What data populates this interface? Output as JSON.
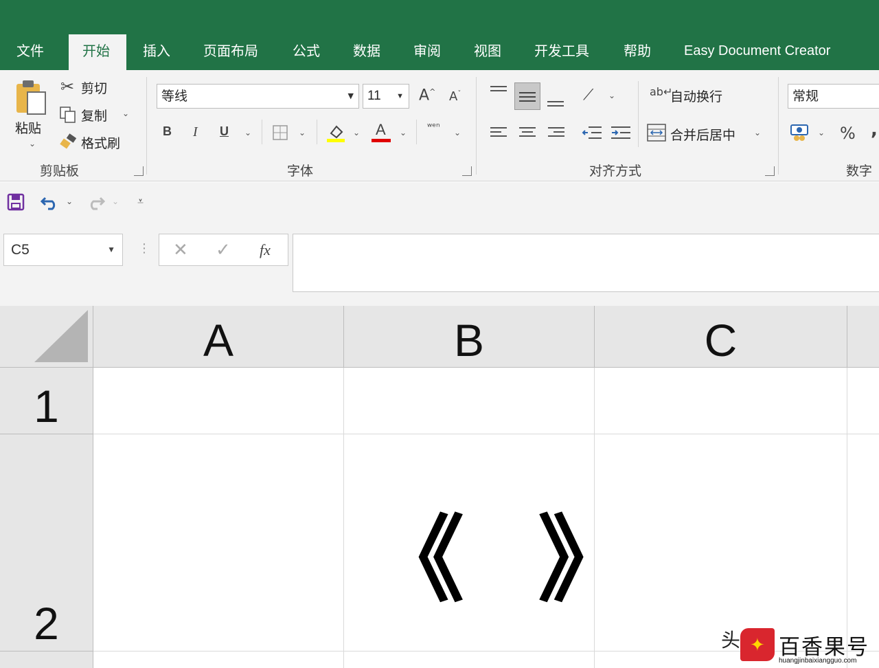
{
  "tabs": {
    "file": "文件",
    "home": "开始",
    "insert": "插入",
    "page_layout": "页面布局",
    "formulas": "公式",
    "data": "数据",
    "review": "审阅",
    "view": "视图",
    "developer": "开发工具",
    "help": "帮助",
    "addin": "Easy Document Creator"
  },
  "clipboard": {
    "paste": "粘贴",
    "cut": "剪切",
    "copy": "复制",
    "format_painter": "格式刷",
    "group_label": "剪贴板"
  },
  "font": {
    "font_name": "等线",
    "font_size": "11",
    "bold": "B",
    "italic": "I",
    "underline": "U",
    "font_color_glyph": "A",
    "group_label": "字体"
  },
  "alignment": {
    "wrap_text": "自动换行",
    "merge_center": "合并后居中",
    "group_label": "对齐方式"
  },
  "number": {
    "format": "常规",
    "percent": "%",
    "comma": ",",
    "group_label": "数字"
  },
  "formula_bar": {
    "name_box": "C5",
    "fx": "fx",
    "content": ""
  },
  "grid": {
    "columns": [
      "A",
      "B",
      "C"
    ],
    "rows": [
      "1",
      "2"
    ],
    "b2_text": "《 》"
  },
  "watermark": {
    "prefix": "头",
    "brand": "百香果号",
    "url": "huangjinbaixiangguo.com"
  },
  "colors": {
    "excel_green": "#217346",
    "ribbon_bg": "#f3f3f3",
    "header_bg": "#e6e6e6"
  }
}
